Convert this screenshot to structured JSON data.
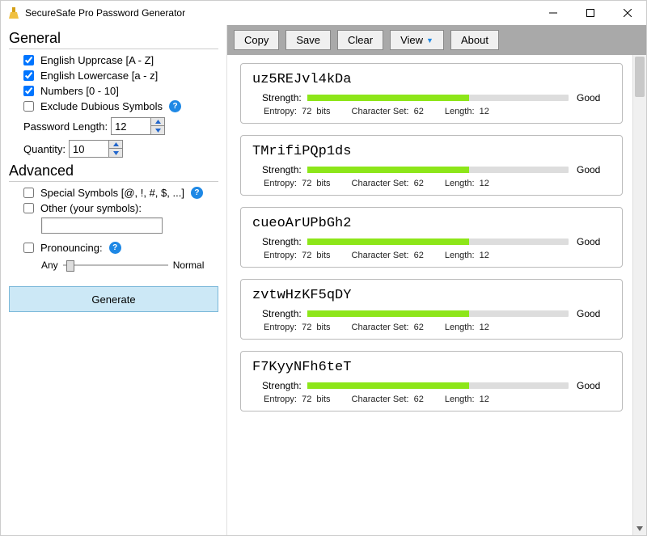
{
  "window": {
    "title": "SecureSafe Pro Password Generator"
  },
  "sidebar": {
    "general": {
      "heading": "General",
      "uppercase_label": "English Upprcase [A - Z]",
      "uppercase_checked": true,
      "lowercase_label": "English Lowercase [a - z]",
      "lowercase_checked": true,
      "numbers_label": "Numbers [0 - 10]",
      "numbers_checked": true,
      "exclude_label": "Exclude Dubious Symbols",
      "exclude_checked": false,
      "length_label": "Password Length:",
      "length_value": "12",
      "quantity_label": "Quantity:",
      "quantity_value": "10"
    },
    "advanced": {
      "heading": "Advanced",
      "special_label": "Special Symbols [@, !, #, $, ...]",
      "special_checked": false,
      "other_label": "Other (your symbols):",
      "other_checked": false,
      "other_value": "",
      "pronounce_label": "Pronouncing:",
      "pronounce_checked": false,
      "slider_left": "Any",
      "slider_right": "Normal"
    },
    "generate_label": "Generate"
  },
  "toolbar": {
    "copy": "Copy",
    "save": "Save",
    "clear": "Clear",
    "view": "View",
    "about": "About"
  },
  "results": [
    {
      "password": "uz5REJvl4kDa",
      "strength_label": "Strength:",
      "strength_pct": 62,
      "rating": "Good",
      "entropy_label": "Entropy:",
      "entropy": "72",
      "entropy_unit": "bits",
      "charset_label": "Character Set:",
      "charset": "62",
      "length_label": "Length:",
      "length": "12"
    },
    {
      "password": "TMrifiPQp1ds",
      "strength_label": "Strength:",
      "strength_pct": 62,
      "rating": "Good",
      "entropy_label": "Entropy:",
      "entropy": "72",
      "entropy_unit": "bits",
      "charset_label": "Character Set:",
      "charset": "62",
      "length_label": "Length:",
      "length": "12"
    },
    {
      "password": "cueoArUPbGh2",
      "strength_label": "Strength:",
      "strength_pct": 62,
      "rating": "Good",
      "entropy_label": "Entropy:",
      "entropy": "72",
      "entropy_unit": "bits",
      "charset_label": "Character Set:",
      "charset": "62",
      "length_label": "Length:",
      "length": "12"
    },
    {
      "password": "zvtwHzKF5qDY",
      "strength_label": "Strength:",
      "strength_pct": 62,
      "rating": "Good",
      "entropy_label": "Entropy:",
      "entropy": "72",
      "entropy_unit": "bits",
      "charset_label": "Character Set:",
      "charset": "62",
      "length_label": "Length:",
      "length": "12"
    },
    {
      "password": "F7KyyNFh6teT",
      "strength_label": "Strength:",
      "strength_pct": 62,
      "rating": "Good",
      "entropy_label": "Entropy:",
      "entropy": "72",
      "entropy_unit": "bits",
      "charset_label": "Character Set:",
      "charset": "62",
      "length_label": "Length:",
      "length": "12"
    }
  ]
}
